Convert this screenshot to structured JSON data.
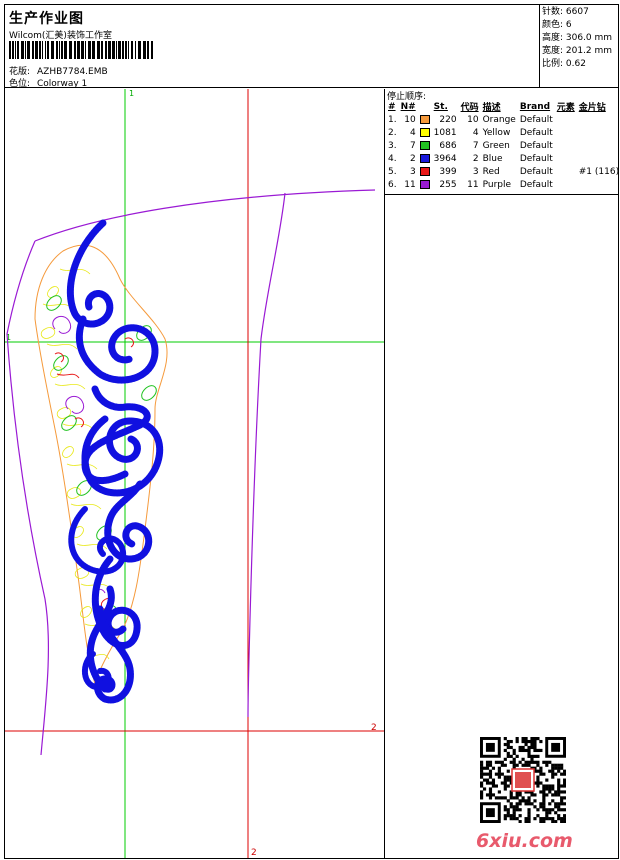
{
  "header": {
    "title": "生产作业图",
    "company": "Wilcom(汇美)装饰工作室",
    "design_label": "花版:",
    "design_value": "AZHB7784.EMB",
    "colorway_label": "色位:",
    "colorway_value": "Colorway 1"
  },
  "stats": {
    "stitches": "针数: 6607",
    "colors": "颜色: 6",
    "height": "高度: 306.0 mm",
    "width": "宽度: 201.2 mm",
    "scale": "比例: 0.62"
  },
  "sequence": {
    "title": "停止顺序:",
    "columns": [
      "#",
      "N#",
      "St.",
      "代码",
      "描述",
      "Brand",
      "元素",
      "金片钻"
    ],
    "rows": [
      {
        "idx": "1.",
        "n": "10",
        "color": "#f59a3c",
        "st": "220",
        "code": "10",
        "desc": "Orange",
        "brand": "Default",
        "elem": "",
        "seq": ""
      },
      {
        "idx": "2.",
        "n": "4",
        "color": "#ffff00",
        "st": "1081",
        "code": "4",
        "desc": "Yellow",
        "brand": "Default",
        "elem": "",
        "seq": ""
      },
      {
        "idx": "3.",
        "n": "7",
        "color": "#22c322",
        "st": "686",
        "code": "7",
        "desc": "Green",
        "brand": "Default",
        "elem": "",
        "seq": ""
      },
      {
        "idx": "4.",
        "n": "2",
        "color": "#1a1adc",
        "st": "3964",
        "code": "2",
        "desc": "Blue",
        "brand": "Default",
        "elem": "",
        "seq": ""
      },
      {
        "idx": "5.",
        "n": "3",
        "color": "#e81818",
        "st": "399",
        "code": "3",
        "desc": "Red",
        "brand": "Default",
        "elem": "",
        "seq": "#1 (116)"
      },
      {
        "idx": "6.",
        "n": "11",
        "color": "#9a1ad4",
        "st": "255",
        "code": "11",
        "desc": "Purple",
        "brand": "Default",
        "elem": "",
        "seq": ""
      }
    ]
  },
  "canvas": {
    "marker_1_top": "1",
    "marker_1_left": "1",
    "marker_2_right": "2",
    "marker_2_bottom": "2",
    "colors": {
      "green_guide": "#00cc00",
      "red_guide": "#dd0000",
      "outline": "#9a1ad4",
      "blue": "#1010e0",
      "orange": "#f59a3c",
      "yellow": "#e6e600",
      "green": "#22c322",
      "red": "#e81818"
    }
  },
  "watermark": {
    "text": "6xiu.com",
    "qr_icon": "qr-code-icon"
  }
}
